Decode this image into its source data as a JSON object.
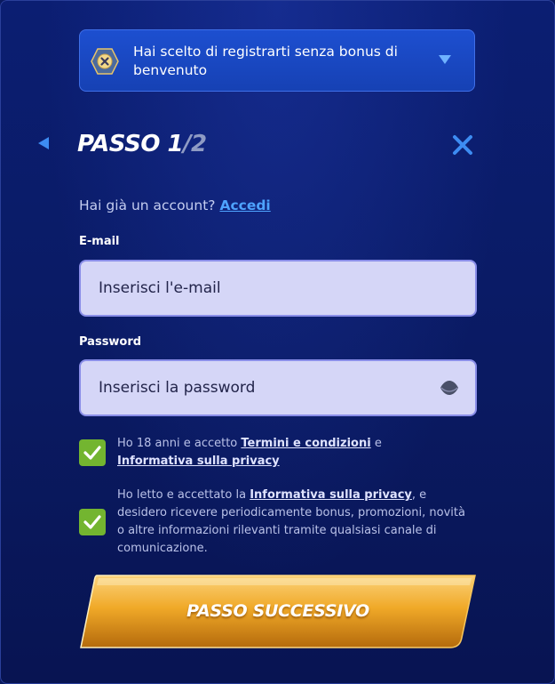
{
  "banner": {
    "text": "Hai scelto di registrarti senza bonus di benvenuto",
    "icon": "no-bonus-icon",
    "caret_icon": "chevron-down-icon"
  },
  "step": {
    "label": "PASSO 1",
    "total": "/2"
  },
  "login_prompt": {
    "text": "Hai già un account?",
    "link": "Accedi"
  },
  "email": {
    "label": "E-mail",
    "placeholder": "Inserisci l'e-mail",
    "value": ""
  },
  "password": {
    "label": "Password",
    "placeholder": "Inserisci la password",
    "value": ""
  },
  "consents": [
    {
      "checked": true,
      "text_before": "Ho 18 anni e accetto",
      "link1": "Termini e condizioni",
      "text_mid": "e",
      "link2": "Informativa sulla privacy"
    },
    {
      "checked": true,
      "text_before": "Ho letto e accettato la",
      "link1": "Informativa sulla privacy",
      "text_after": ", e desidero ricevere periodicamente bonus, promozioni, novità o altre informazioni rilevanti tramite qualsiasi canale di comunicazione."
    }
  ],
  "cta": {
    "label": "PASSO SUCCESSIVO"
  },
  "colors": {
    "background": "#0a1a62",
    "banner": "#1a47c4",
    "link": "#4ea3ff",
    "checkbox": "#73b530",
    "cta_gold": "#f2b02e",
    "input_bg": "#d5d6f7"
  }
}
